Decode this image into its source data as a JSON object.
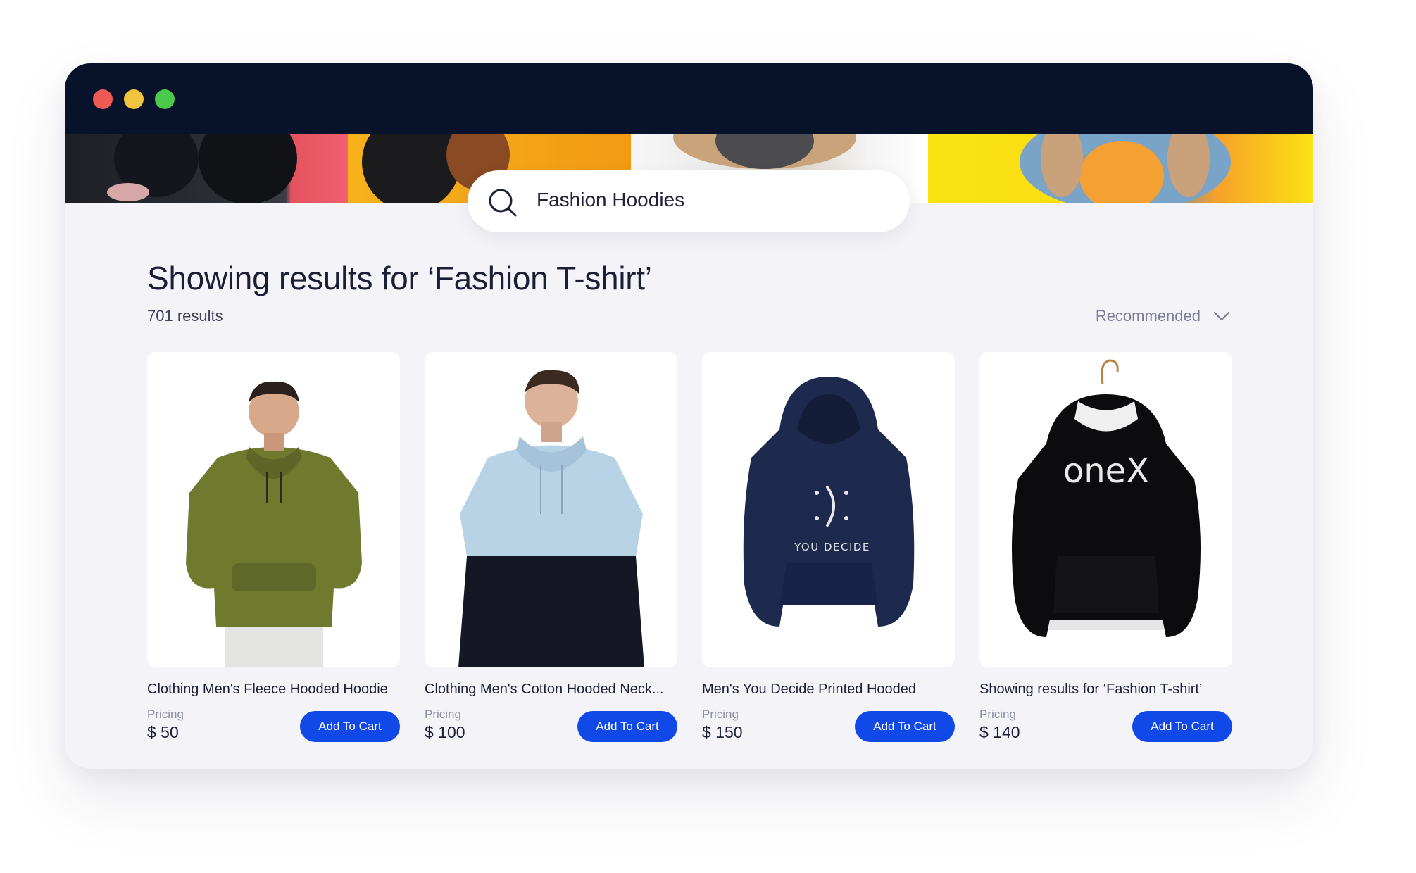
{
  "search": {
    "query": "Fashion Hoodies"
  },
  "results": {
    "heading": "Showing results for ‘Fashion T-shirt’",
    "count": "701 results",
    "sort_label": "Recommended"
  },
  "products": [
    {
      "title": "Clothing Men's Fleece Hooded Hoodie",
      "pricing_label": "Pricing",
      "price": "$ 50",
      "cart_label": "Add To Cart"
    },
    {
      "title": "Clothing Men's Cotton Hooded Neck...",
      "pricing_label": "Pricing",
      "price": "$ 100",
      "cart_label": "Add To Cart"
    },
    {
      "title": "Men's You Decide Printed Hooded",
      "pricing_label": "Pricing",
      "price": "$ 150",
      "cart_label": "Add To Cart",
      "print_text": "YOU DECIDE"
    },
    {
      "title": "Showing results for ‘Fashion T-shirt’",
      "pricing_label": "Pricing",
      "price": "$ 140",
      "cart_label": "Add To Cart",
      "print_text": "oneX"
    }
  ],
  "colors": {
    "titlebar": "#08122a",
    "accent": "#1149e8",
    "window_bg": "#f4f4f8",
    "dot_red": "#ef5a55",
    "dot_yellow": "#f0c43c",
    "dot_green": "#4cc84a"
  },
  "icons": {
    "search": "search-icon",
    "sort": "chevron-down-icon"
  }
}
